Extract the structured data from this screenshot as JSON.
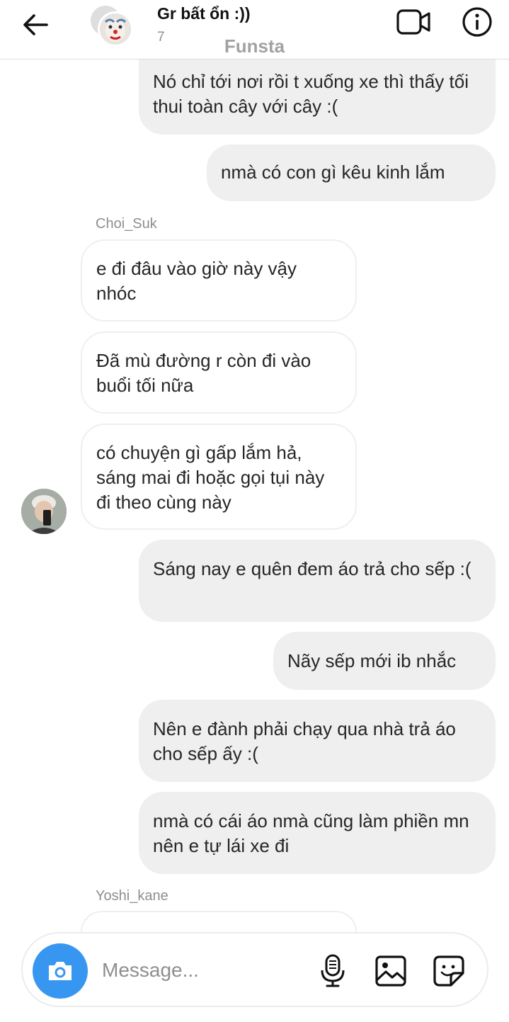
{
  "header": {
    "title": "Gr bất ổn :))",
    "subtitle": "7",
    "watermark": "Funsta"
  },
  "messages": [
    {
      "direction": "out",
      "text": "Nó chỉ tới nơi rồi t xuống xe thì thấy tối thui toàn cây với cây :("
    },
    {
      "direction": "out",
      "text": "nmà có con gì kêu kinh lắm"
    },
    {
      "direction": "in",
      "sender": "Choi_Suk",
      "text": "e đi đâu vào giờ này vậy nhóc"
    },
    {
      "direction": "in",
      "text": "Đã mù đường r còn đi vào buổi tối nữa"
    },
    {
      "direction": "in",
      "text": "có chuyện gì gấp lắm hả, sáng mai đi hoặc gọi tụi này đi theo cùng này"
    },
    {
      "direction": "out",
      "text": "Sáng nay e quên đem áo trả cho sếp :("
    },
    {
      "direction": "out",
      "text": "Nãy sếp mới ib nhắc"
    },
    {
      "direction": "out",
      "text": "Nên e đành phải chạy qua nhà trả áo cho sếp ấy :("
    },
    {
      "direction": "out",
      "text": "nmà có cái áo nmà cũng làm phiền mn nên e tự lái xe đi"
    },
    {
      "direction": "in",
      "sender": "Yoshi_kane",
      "text": ""
    }
  ],
  "senders": {
    "first": "Choi_Suk",
    "second": "Yoshi_kane"
  },
  "composer": {
    "placeholder": "Message..."
  },
  "icons": {
    "back": "arrow-left-icon",
    "video": "video-camera-icon",
    "info": "info-icon",
    "camera": "camera-icon",
    "mic": "microphone-icon",
    "gallery": "image-icon",
    "sticker": "sticker-icon"
  },
  "colors": {
    "accent": "#3797f0",
    "bubble_out": "#efefef",
    "text": "#262626",
    "muted": "#8e8e8e"
  }
}
